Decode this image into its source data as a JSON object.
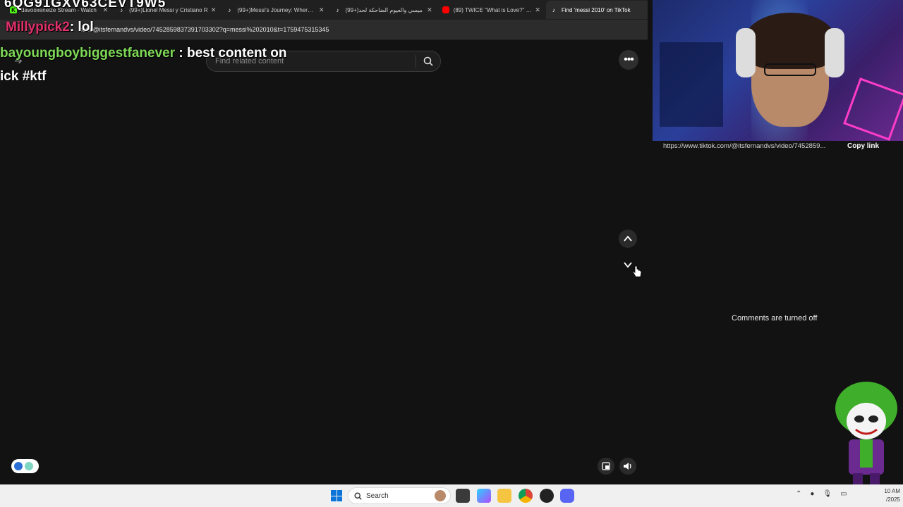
{
  "browser": {
    "tabs": [
      {
        "title": "davooxeneize Stream - Watch",
        "favicon": "kick-icon",
        "active": false
      },
      {
        "title": "(99+)Lionel Messi y Cristiano R",
        "favicon": "tiktok-icon",
        "active": false
      },
      {
        "title": "(99+)Messi's Journey: Where H",
        "favicon": "tiktok-icon",
        "active": false
      },
      {
        "title": "(99+)ميسي والعيوم الضاحكة لحد",
        "favicon": "tiktok-icon",
        "active": false
      },
      {
        "title": "(89) TWICE \"What is Love?\" M/",
        "favicon": "youtube-icon",
        "active": false
      },
      {
        "title": "Find 'messi 2010' on TikTok",
        "favicon": "tiktok-icon",
        "active": true
      }
    ],
    "url": "com/@itsfernandvs/video/7452859837391703302?q=messi%202010&t=1759475315345"
  },
  "tiktok": {
    "search_placeholder": "Find related content",
    "more_label": "•••"
  },
  "right_panel": {
    "share_url": "https://www.tiktok.com/@itsfernandvs/video/7452859...",
    "copy_link_label": "Copy link",
    "comments_status": "Comments are turned off"
  },
  "overlay": {
    "code_text": "6QG91GXV63CEVT9W5",
    "chat": [
      {
        "user": "Millypick2",
        "message": ": lol"
      },
      {
        "user": "bayoungboybiggestfanever",
        "message": " : best content on"
      },
      {
        "user": "",
        "message": "ick #ktf"
      }
    ]
  },
  "taskbar": {
    "search_label": "Search",
    "clock_time": "10 AM",
    "clock_date": "/2025"
  },
  "colors": {
    "page_bg": "#121212",
    "chat_user1": "#e0306a",
    "chat_user2": "#7ed957",
    "accent_blue": "#0b74d8"
  }
}
